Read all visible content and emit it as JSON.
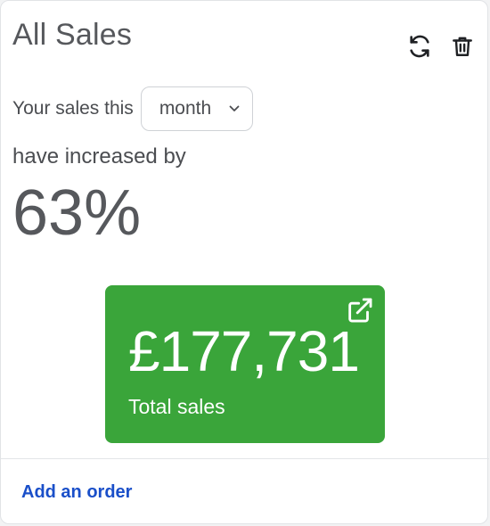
{
  "widget": {
    "title": "All Sales",
    "icons": {
      "refresh": "refresh-icon",
      "delete": "trash-icon",
      "external": "external-link-icon",
      "dropdown": "chevron-down-icon"
    }
  },
  "period": {
    "label": "Your sales this",
    "selected": "month"
  },
  "summary": {
    "increase_text": "have increased by",
    "percent": "63%"
  },
  "tile": {
    "amount": "£177,731",
    "label": "Total sales",
    "color": "#3aa53a"
  },
  "footer": {
    "link_label": "Add an order",
    "link_color": "#1a4fc9"
  }
}
